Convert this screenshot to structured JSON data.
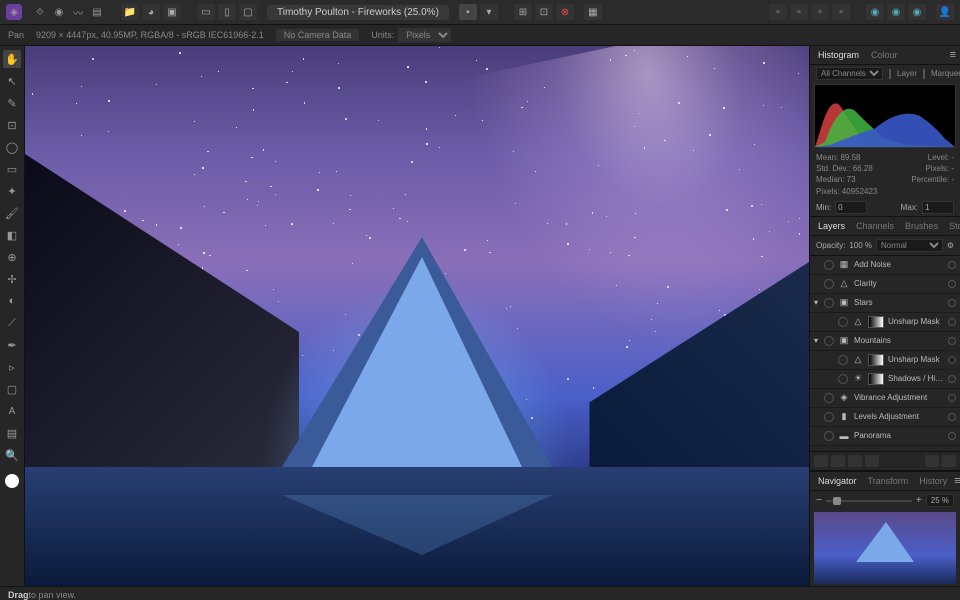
{
  "title": "Timothy Poulton - Fireworks (25.0%)",
  "infobar": {
    "tool": "Pan",
    "doc": "9209 × 4447px, 40.95MP, RGBA/8 - sRGB IEC61966-2.1",
    "camera": "No Camera Data",
    "units_label": "Units:",
    "units_value": "Pixels"
  },
  "histogram": {
    "tabs": [
      "Histogram",
      "Colour"
    ],
    "channels": "All Channels",
    "layer": "Layer",
    "marquee": "Marquee",
    "stats": {
      "mean": "Mean: 89.58",
      "stddev": "Std. Dev.: 66.28",
      "median": "Median: 73",
      "pixels": "Pixels: 40952423",
      "level": "Level: -",
      "pixels2": "Pixels: -",
      "percentile": "Percentile: -"
    },
    "min_label": "Min:",
    "min_value": "0",
    "max_label": "Max:",
    "max_value": "1"
  },
  "layers_panel": {
    "tabs": [
      "Layers",
      "Channels",
      "Brushes",
      "Stock"
    ],
    "opacity_label": "Opacity:",
    "opacity_value": "100 %",
    "blend": "Normal",
    "items": [
      {
        "name": "Add Noise",
        "icon": "fx"
      },
      {
        "name": "Clarity",
        "icon": "tri"
      },
      {
        "name": "Stars",
        "icon": "img",
        "group": true
      },
      {
        "name": "Unsharp Mask",
        "icon": "tri",
        "child": true,
        "mask": true
      },
      {
        "name": "Mountains",
        "icon": "img",
        "group": true
      },
      {
        "name": "Unsharp Mask",
        "icon": "tri",
        "child": true,
        "mask": true
      },
      {
        "name": "Shadows / Highligh",
        "icon": "sun",
        "child": true,
        "mask": true
      },
      {
        "name": "Vibrance Adjustment",
        "icon": "diamond"
      },
      {
        "name": "Levels Adjustment",
        "icon": "bars"
      },
      {
        "name": "Panorama",
        "icon": "pano"
      }
    ]
  },
  "navigator": {
    "tabs": [
      "Navigator",
      "Transform",
      "History"
    ],
    "zoom": "25 %"
  },
  "statusbar": {
    "action": "Drag",
    "hint": " to pan view."
  }
}
